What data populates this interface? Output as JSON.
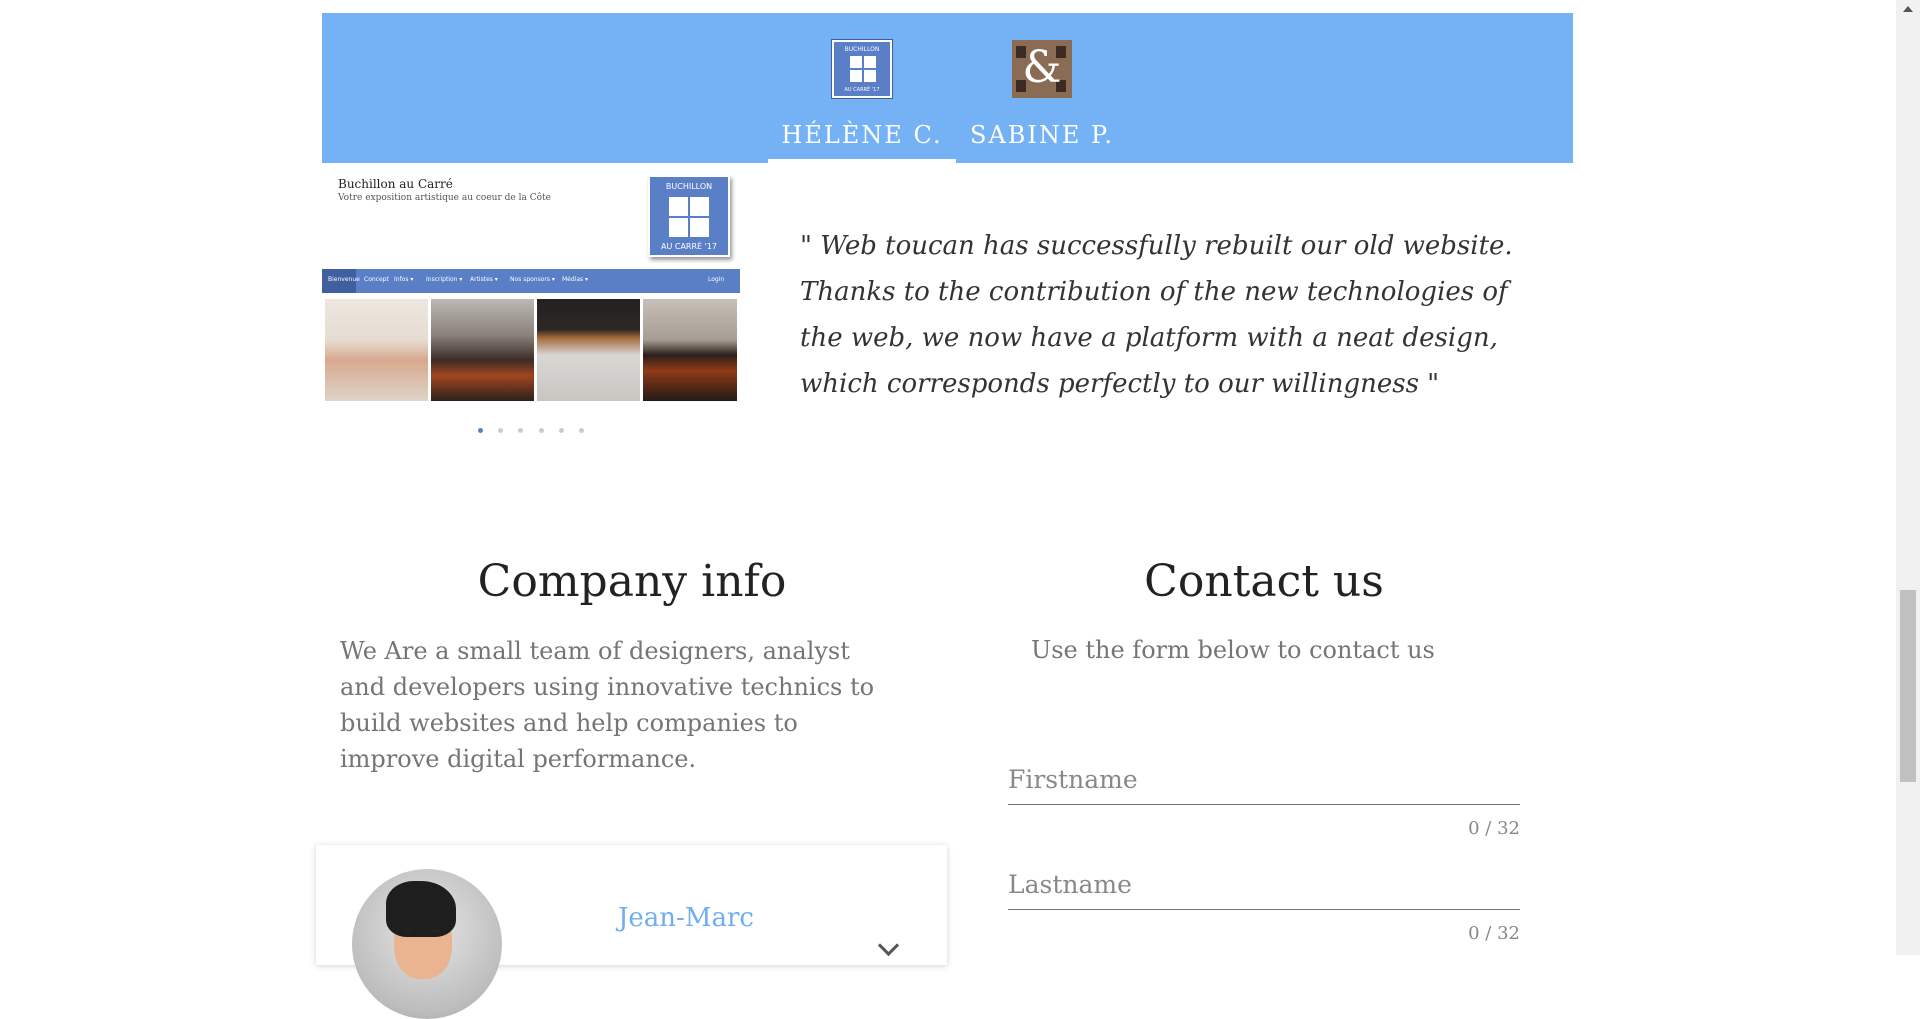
{
  "testimonials": {
    "tabs": [
      {
        "name": "HÉLÈNE C.",
        "active": true,
        "logo": "buchillon-logo-icon"
      },
      {
        "name": "SABINE P.",
        "active": false,
        "logo": "ampersand-logo-icon"
      }
    ],
    "screenshot": {
      "site_title": "Buchillon au Carré",
      "site_subtitle": "Votre exposition artistique au coeur de la Côte",
      "badge_top": "BUCHILLON",
      "badge_bottom": "AU CARRÉ '17",
      "logo_top": "BUCHILLON",
      "logo_bottom": "AU CARRÉ '17",
      "nav": [
        "Bienvenue",
        "Concept",
        "Infos ▾",
        "Inscription ▾",
        "Artistes ▾",
        "Nos sponsors ▾",
        "Médias ▾",
        "Login"
      ],
      "carousel_dots": 6,
      "carousel_active": 0
    },
    "quote": "\" Web toucan has successfully rebuilt our old website. Thanks to the contribution of the new technologies of the web, we now have a platform with a neat design, which corresponds perfectly to our willingness \""
  },
  "company": {
    "title": "Company info",
    "text": "We Are a small team of designers, analyst and developers using innovative technics to build websites and help companies to improve digital performance.",
    "member": {
      "name": "Jean-Marc"
    }
  },
  "contact": {
    "title": "Contact us",
    "subtitle": "Use the form below to contact us",
    "fields": [
      {
        "label": "Firstname",
        "counter": "0 / 32"
      },
      {
        "label": "Lastname",
        "counter": "0 / 32"
      }
    ]
  },
  "colors": {
    "accent": "#75b2f5",
    "link": "#6faef1",
    "brand_logo": "#5a7fc6"
  }
}
